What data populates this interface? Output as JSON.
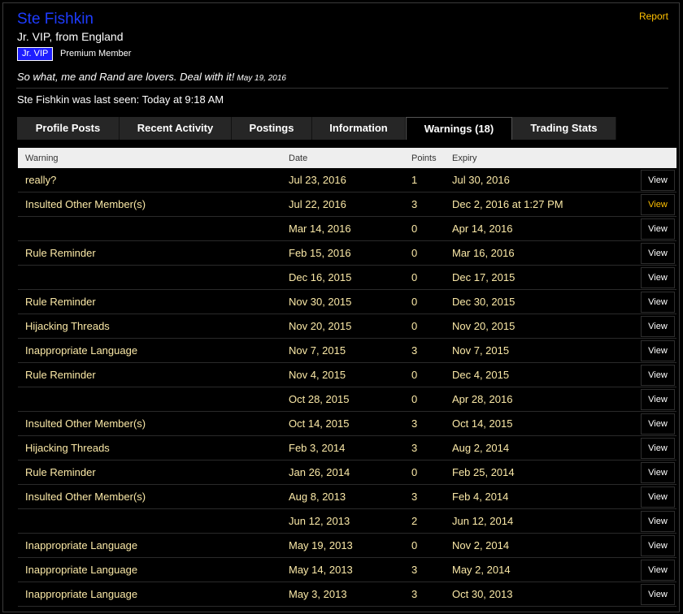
{
  "profile": {
    "username": "Ste Fishkin",
    "report_label": "Report",
    "user_title": "Jr. VIP, from England",
    "banner": "Jr. VIP",
    "member_type": "Premium Member",
    "status_text": "So what, me and Rand are lovers. Deal with it!",
    "status_date": "May 19, 2016",
    "last_seen": "Ste Fishkin was last seen: Today at 9:18 AM"
  },
  "tabs": [
    {
      "label": "Profile Posts"
    },
    {
      "label": "Recent Activity"
    },
    {
      "label": "Postings"
    },
    {
      "label": "Information"
    },
    {
      "label": "Warnings (18)"
    },
    {
      "label": "Trading Stats"
    }
  ],
  "table": {
    "headers": {
      "warning": "Warning",
      "date": "Date",
      "points": "Points",
      "expiry": "Expiry"
    },
    "view_label": "View",
    "rows": [
      {
        "warning": "really?",
        "date": "Jul 23, 2016",
        "points": "1",
        "expiry": "Jul 30, 2016"
      },
      {
        "warning": "Insulted Other Member(s)",
        "date": "Jul 22, 2016",
        "points": "3",
        "expiry": "Dec 2, 2016 at 1:27 PM"
      },
      {
        "warning": "",
        "date": "Mar 14, 2016",
        "points": "0",
        "expiry": "Apr 14, 2016"
      },
      {
        "warning": "Rule Reminder",
        "date": "Feb 15, 2016",
        "points": "0",
        "expiry": "Mar 16, 2016"
      },
      {
        "warning": "",
        "date": "Dec 16, 2015",
        "points": "0",
        "expiry": "Dec 17, 2015"
      },
      {
        "warning": "Rule Reminder",
        "date": "Nov 30, 2015",
        "points": "0",
        "expiry": "Dec 30, 2015"
      },
      {
        "warning": "Hijacking Threads",
        "date": "Nov 20, 2015",
        "points": "0",
        "expiry": "Nov 20, 2015"
      },
      {
        "warning": "Inappropriate Language",
        "date": "Nov 7, 2015",
        "points": "3",
        "expiry": "Nov 7, 2015"
      },
      {
        "warning": "Rule Reminder",
        "date": "Nov 4, 2015",
        "points": "0",
        "expiry": "Dec 4, 2015"
      },
      {
        "warning": "",
        "date": "Oct 28, 2015",
        "points": "0",
        "expiry": "Apr 28, 2016"
      },
      {
        "warning": "Insulted Other Member(s)",
        "date": "Oct 14, 2015",
        "points": "3",
        "expiry": "Oct 14, 2015"
      },
      {
        "warning": "Hijacking Threads",
        "date": "Feb 3, 2014",
        "points": "3",
        "expiry": "Aug 2, 2014"
      },
      {
        "warning": "Rule Reminder",
        "date": "Jan 26, 2014",
        "points": "0",
        "expiry": "Feb 25, 2014"
      },
      {
        "warning": "Insulted Other Member(s)",
        "date": "Aug 8, 2013",
        "points": "3",
        "expiry": "Feb 4, 2014"
      },
      {
        "warning": "",
        "date": "Jun 12, 2013",
        "points": "2",
        "expiry": "Jun 12, 2014"
      },
      {
        "warning": "Inappropriate Language",
        "date": "May 19, 2013",
        "points": "0",
        "expiry": "Nov 2, 2014"
      },
      {
        "warning": "Inappropriate Language",
        "date": "May 14, 2013",
        "points": "3",
        "expiry": "May 2, 2014"
      },
      {
        "warning": "Inappropriate Language",
        "date": "May 3, 2013",
        "points": "3",
        "expiry": "Oct 30, 2013"
      }
    ]
  },
  "colors": {
    "username": "#1e3cff",
    "accent": "#ffc000",
    "row_text": "#fbe9a7",
    "banner_bg": "#1e1eff"
  }
}
